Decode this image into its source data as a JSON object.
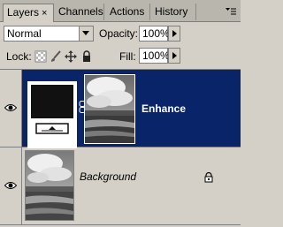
{
  "tabs": [
    {
      "label": "Layers",
      "active": true,
      "close": "×"
    },
    {
      "label": "Channels",
      "active": false
    },
    {
      "label": "Actions",
      "active": false
    },
    {
      "label": "History",
      "active": false
    }
  ],
  "blend_mode": "Normal",
  "opacity": {
    "label": "Opacity:",
    "value": "100%"
  },
  "lock_label": "Lock:",
  "fill": {
    "label": "Fill:",
    "value": "100%"
  },
  "layers": [
    {
      "name": "Enhance",
      "selected": true,
      "type": "adjustment",
      "visible": true
    },
    {
      "name": "Background",
      "selected": false,
      "type": "image",
      "visible": true,
      "locked": true
    }
  ],
  "colors": {
    "selection": "#0a246a",
    "panel": "#d4d0c8"
  },
  "icons": [
    "panel-menu-icon",
    "dropdown-arrow-icon",
    "stepper-arrow-icon",
    "lock-transparency-icon",
    "lock-brush-icon",
    "lock-move-icon",
    "lock-all-icon",
    "eye-icon",
    "chain-link-icon",
    "lock-icon"
  ]
}
